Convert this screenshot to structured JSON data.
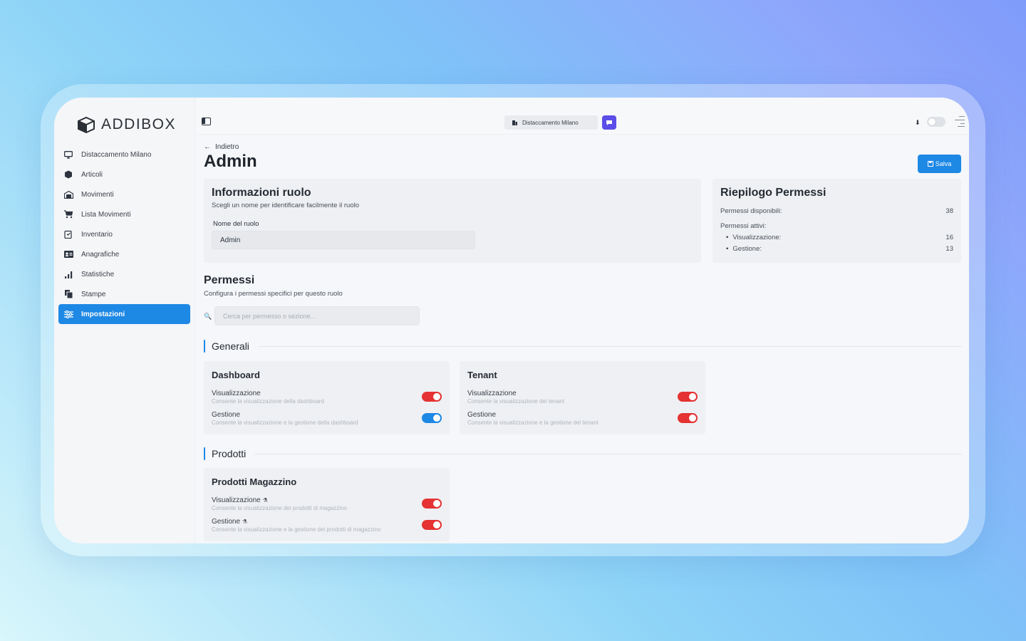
{
  "brand": {
    "name": "ADDIBOX"
  },
  "sidebar": {
    "items": [
      {
        "label": "Distaccamento Milano",
        "icon": "monitor-icon"
      },
      {
        "label": "Articoli",
        "icon": "box-icon"
      },
      {
        "label": "Movimenti",
        "icon": "warehouse-icon"
      },
      {
        "label": "Lista Movimenti",
        "icon": "cart-icon"
      },
      {
        "label": "Inventario",
        "icon": "clipboard-icon"
      },
      {
        "label": "Anagrafiche",
        "icon": "id-card-icon"
      },
      {
        "label": "Statistiche",
        "icon": "bar-chart-icon"
      },
      {
        "label": "Stampe",
        "icon": "copy-icon"
      },
      {
        "label": "Impostazioni",
        "icon": "sliders-icon",
        "active": true
      }
    ]
  },
  "topbar": {
    "location": "Distaccamento Milano"
  },
  "header": {
    "back_label": "Indietro",
    "title": "Admin",
    "save_label": "Salva"
  },
  "role_info": {
    "title": "Informazioni ruolo",
    "subtitle": "Scegli un nome per identificare facilmente il ruolo",
    "field_label": "Nome del ruolo",
    "field_value": "Admin"
  },
  "summary": {
    "title": "Riepilogo Permessi",
    "available_label": "Permessi disponibili:",
    "available_value": "38",
    "active_label": "Permessi attivi:",
    "view_label": "Visualizzazione:",
    "view_value": "16",
    "manage_label": "Gestione:",
    "manage_value": "13"
  },
  "permissions": {
    "title": "Permessi",
    "subtitle": "Configura i permessi specifici per questo ruolo",
    "search_placeholder": "Cerca per permesso o sezione..."
  },
  "sections": [
    {
      "name": "Generali",
      "cards": [
        {
          "title": "Dashboard",
          "perms": [
            {
              "name": "Visualizzazione",
              "desc": "Consente la visualizzazione della dashboard",
              "color": "#e53232"
            },
            {
              "name": "Gestione",
              "desc": "Consente la visualizzazione e la gestione della dashboard",
              "color": "#1e88e5"
            }
          ]
        },
        {
          "title": "Tenant",
          "perms": [
            {
              "name": "Visualizzazione",
              "desc": "Consente la visualizzazione dei tenant",
              "color": "#e53232"
            },
            {
              "name": "Gestione",
              "desc": "Consente la visualizzazione e la gestione dei tenant",
              "color": "#e53232"
            }
          ]
        }
      ]
    },
    {
      "name": "Prodotti",
      "cards": [
        {
          "title": "Prodotti Magazzino",
          "perms": [
            {
              "name": "Visualizzazione",
              "desc": "Consente la visualizzazione dei prodotti di magazzino",
              "color": "#e53232"
            },
            {
              "name": "Gestione",
              "desc": "Consente la visualizzazione e la gestione dei prodotti di magazzino",
              "color": "#e53232"
            }
          ]
        }
      ]
    }
  ]
}
